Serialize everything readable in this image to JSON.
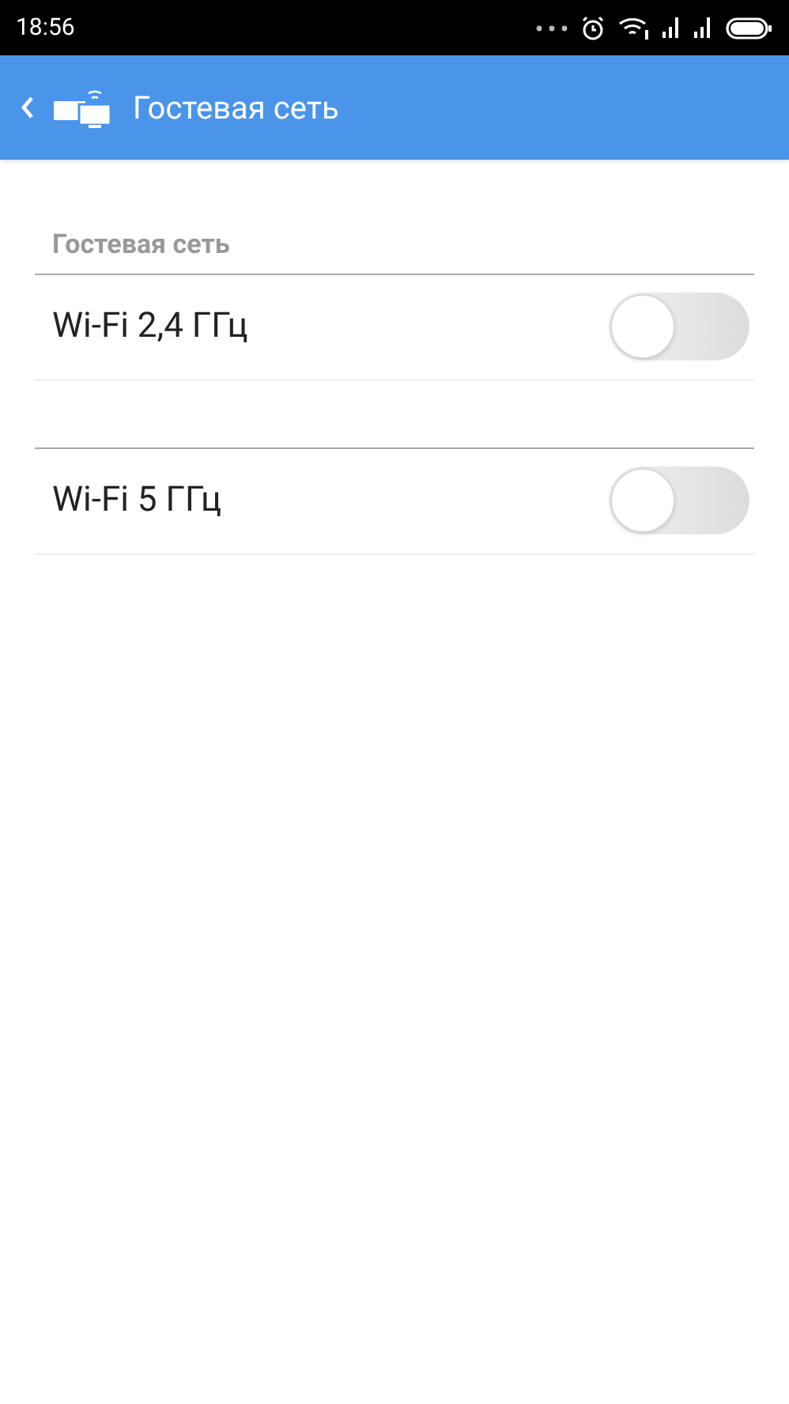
{
  "status_bar": {
    "time": "18:56"
  },
  "app_bar": {
    "title": "Гостевая сеть"
  },
  "sections": [
    {
      "header": "Гостевая сеть",
      "items": [
        {
          "label": "Wi-Fi 2,4 ГГц",
          "on": false
        }
      ]
    },
    {
      "items": [
        {
          "label": "Wi-Fi 5 ГГц",
          "on": false
        }
      ]
    }
  ]
}
